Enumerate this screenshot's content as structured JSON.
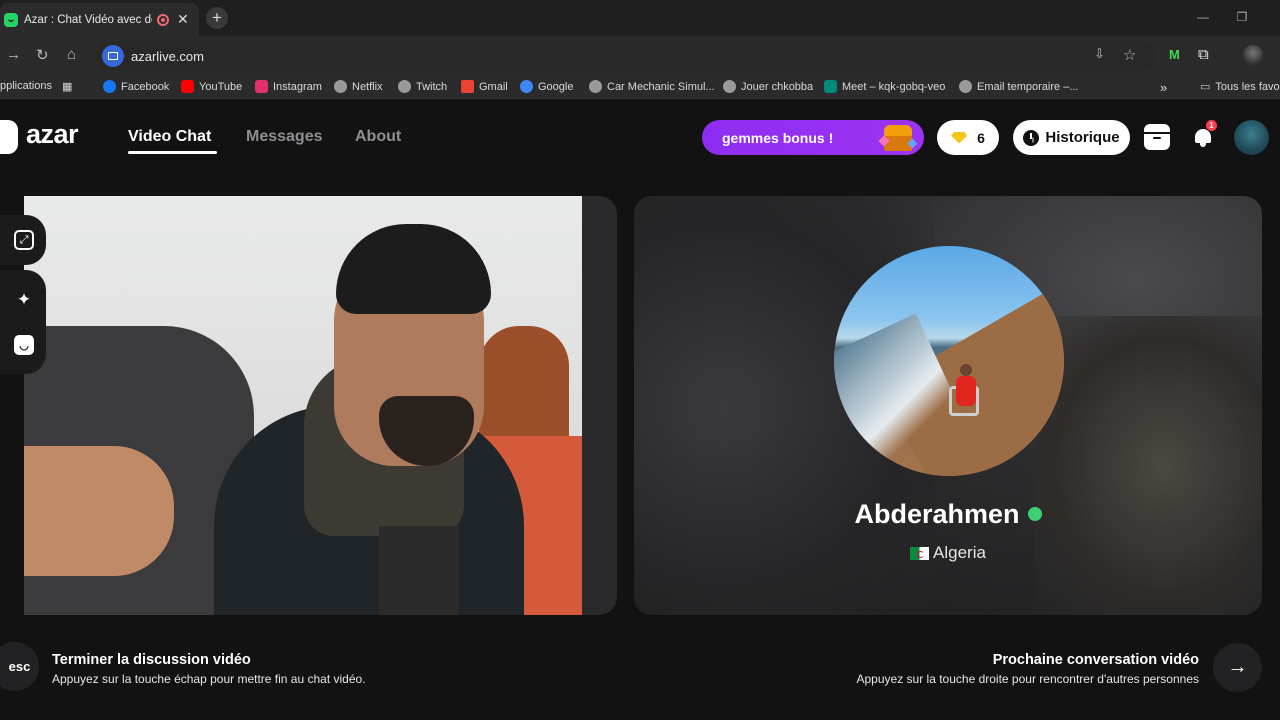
{
  "browser": {
    "tab_title": "Azar : Chat Vidéo avec de n",
    "tab_close": "✕",
    "newtab": "+",
    "url": "azarlive.com",
    "window_controls": [
      "—",
      "❐",
      "✕"
    ],
    "bookmarks": [
      {
        "label": "pplications",
        "icon": "apps-icon",
        "color": "#2b2b2b"
      },
      {
        "label": "Facebook",
        "icon": "facebook-icon",
        "color": "#1877f2"
      },
      {
        "label": "YouTube",
        "icon": "youtube-icon",
        "color": "#ff0000"
      },
      {
        "label": "Instagram",
        "icon": "instagram-icon",
        "color": "#e1306c"
      },
      {
        "label": "Netflix",
        "icon": "globe-icon",
        "color": "#9a9a9a"
      },
      {
        "label": "Twitch",
        "icon": "globe-icon",
        "color": "#9a9a9a"
      },
      {
        "label": "Gmail",
        "icon": "gmail-icon",
        "color": "#ea4335"
      },
      {
        "label": "Google",
        "icon": "google-icon",
        "color": "#4285f4"
      },
      {
        "label": "Car Mechanic Simul...",
        "icon": "globe-icon",
        "color": "#9a9a9a"
      },
      {
        "label": "Jouer chkobba",
        "icon": "globe-icon",
        "color": "#9a9a9a"
      },
      {
        "label": "Meet – kqk-gobq-veo",
        "icon": "meet-icon",
        "color": "#00897b"
      },
      {
        "label": "Email temporaire –...",
        "icon": "globe-icon",
        "color": "#9a9a9a"
      }
    ],
    "overflow": "»",
    "all_bookmarks": "Tous les favo"
  },
  "app": {
    "logo": "azar",
    "nav": [
      "Video Chat",
      "Messages",
      "About"
    ],
    "bonus_label": "gemmes bonus !",
    "gems_count": "6",
    "history_label": "Historique",
    "notif_count": "1"
  },
  "remote": {
    "name": "Abderahmen",
    "country": "Algeria"
  },
  "footer": {
    "esc_label": "esc",
    "end_title": "Terminer la discussion vidéo",
    "end_sub": "Appuyez sur la touche échap pour mettre fin au chat vidéo.",
    "next_title": "Prochaine conversation vidéo",
    "next_sub": "Appuyez sur la touche droite pour rencontrer d'autres personnes",
    "next_arrow": "→"
  },
  "colors": {
    "accent_purple": "#8e2df2",
    "verify_green": "#3cd070",
    "notif_red": "#ff3b4a",
    "gem_yellow": "#f5c518"
  }
}
